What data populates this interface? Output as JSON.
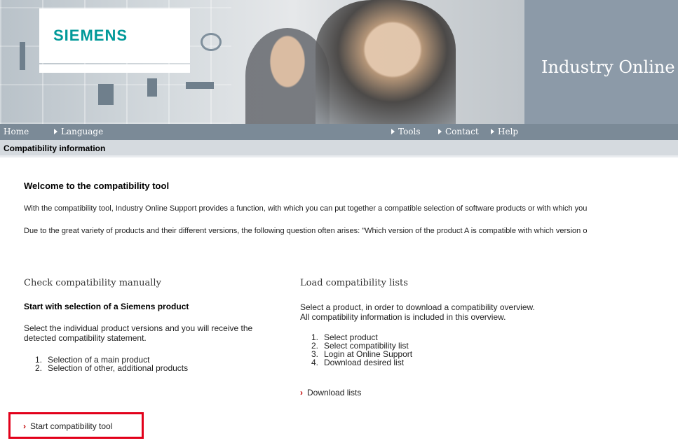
{
  "header": {
    "logo": "SIEMENS",
    "site_title": "Industry Online"
  },
  "nav": {
    "home": "Home",
    "language": "Language",
    "tools": "Tools",
    "contact": "Contact",
    "help": "Help"
  },
  "breadcrumb": "Compatibility information",
  "welcome": {
    "title": "Welcome to the compatibility tool",
    "p1": "With the compatibility tool, Industry Online Support provides a function, with which you can put together a compatible selection of software products or with which you",
    "p2": "Due to the great variety of products and their different versions, the following question often arises: \"Which version of the product A is compatible with which version o"
  },
  "manual": {
    "title": "Check compatibility manually",
    "subtitle": "Start with selection of a Siemens product",
    "desc": "Select the individual product versions and you will receive the detected compatibility statement.",
    "steps": [
      {
        "num": "1.",
        "text": "Selection of a main product"
      },
      {
        "num": "2.",
        "text": "Selection of other, additional products"
      }
    ],
    "start_link": "Start compatibility tool"
  },
  "lists": {
    "title": "Load compatibility lists",
    "desc_line1": "Select a product, in order to download a compatibility overview.",
    "desc_line2": "All compatibility information is included in this overview.",
    "steps": [
      {
        "num": "1.",
        "text": "Select product"
      },
      {
        "num": "2.",
        "text": "Select compatibility list"
      },
      {
        "num": "3.",
        "text": "Login at Online Support"
      },
      {
        "num": "4.",
        "text": "Download desired list"
      }
    ],
    "download_link": "Download lists"
  },
  "colors": {
    "accent_red": "#e2001a",
    "siemens_teal": "#009999",
    "nav_bg": "#7b8a97"
  }
}
